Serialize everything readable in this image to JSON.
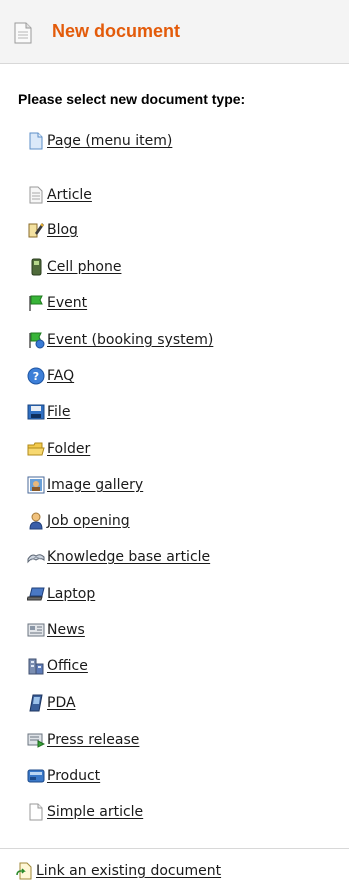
{
  "header": {
    "title": "New document",
    "icon": "document-icon"
  },
  "prompt": "Please select new document type:",
  "page_item": {
    "label": "Page (menu item)",
    "icon": "page-icon"
  },
  "doc_types": [
    {
      "label": "Article",
      "icon": "article-icon"
    },
    {
      "label": "Blog",
      "icon": "blog-icon"
    },
    {
      "label": "Cell phone",
      "icon": "cell-phone-icon"
    },
    {
      "label": "Event",
      "icon": "event-flag-icon"
    },
    {
      "label": "Event (booking system)",
      "icon": "event-booking-icon"
    },
    {
      "label": "FAQ",
      "icon": "help-icon"
    },
    {
      "label": "File",
      "icon": "file-icon"
    },
    {
      "label": "Folder",
      "icon": "folder-icon"
    },
    {
      "label": "Image gallery",
      "icon": "image-gallery-icon"
    },
    {
      "label": "Job opening",
      "icon": "job-opening-icon"
    },
    {
      "label": "Knowledge base article",
      "icon": "knowledge-base-icon"
    },
    {
      "label": "Laptop",
      "icon": "laptop-icon"
    },
    {
      "label": "News",
      "icon": "news-icon"
    },
    {
      "label": "Office",
      "icon": "office-icon"
    },
    {
      "label": "PDA",
      "icon": "pda-icon"
    },
    {
      "label": "Press release",
      "icon": "press-release-icon"
    },
    {
      "label": "Product",
      "icon": "product-icon"
    },
    {
      "label": "Simple article",
      "icon": "simple-article-icon"
    }
  ],
  "link_existing": {
    "label": "Link an existing document",
    "icon": "link-document-icon"
  },
  "colors": {
    "title": "#e35b0a",
    "header_bg": "#f4f4f4",
    "divider": "#d8d8d8"
  }
}
